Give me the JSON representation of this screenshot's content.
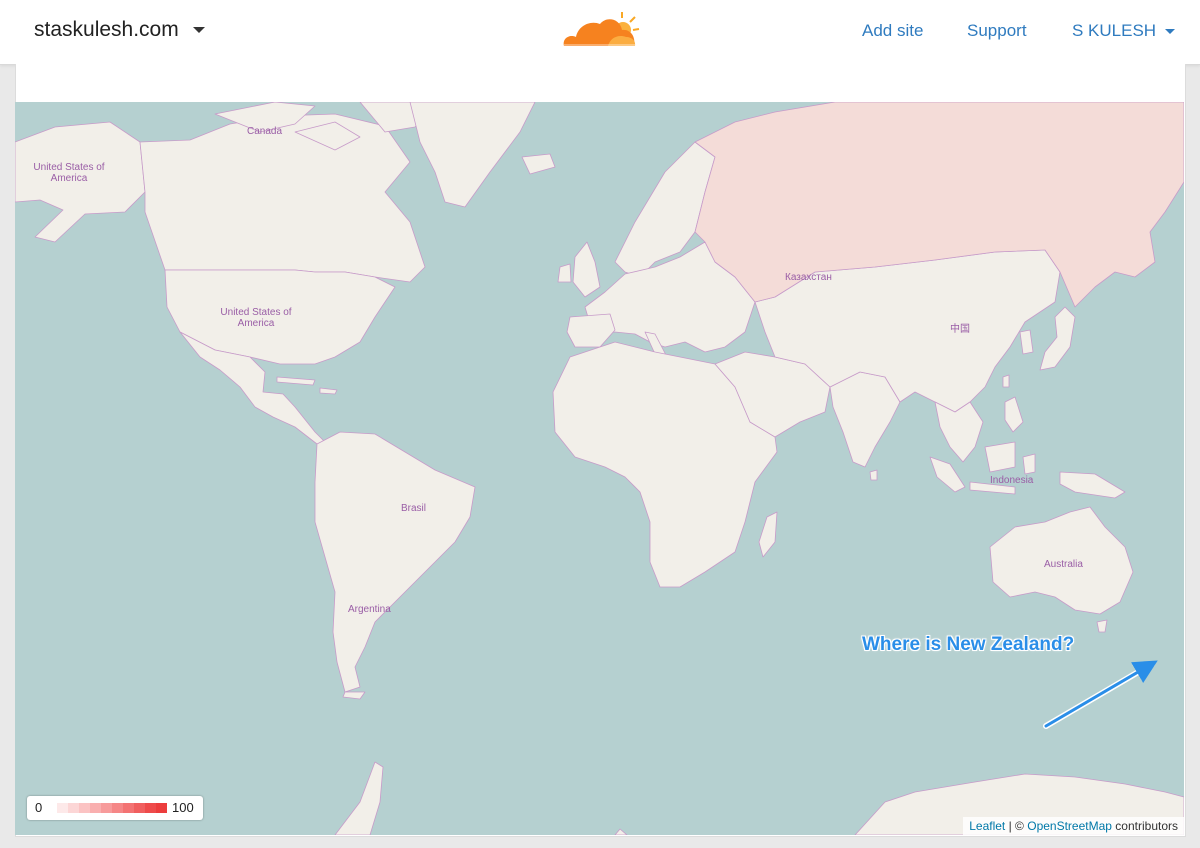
{
  "header": {
    "site_name": "staskulesh.com",
    "nav": {
      "add_site": "Add site",
      "support": "Support",
      "user": "S KULESH"
    },
    "logo_icon": "cloudflare-cloud-icon",
    "accent_color": "#2f7bbf"
  },
  "map": {
    "labels": {
      "canada": "Canada",
      "usa_alaska": "United States of America",
      "usa": "United States of America",
      "kazakhstan": "Казахстан",
      "china": "中国",
      "indonesia": "Indonesia",
      "brasil": "Brasil",
      "argentina": "Argentina",
      "australia": "Australia"
    },
    "colors": {
      "ocean": "#b5d0d0",
      "land": "#f2efe9",
      "highlight": "#f4dcd8",
      "border": "#c79bc9"
    },
    "highlighted_country": "Russia",
    "legend": {
      "min": "0",
      "max": "100",
      "ramp": [
        "#fde9e9",
        "#fcd6d6",
        "#fbc3c3",
        "#f9afaf",
        "#f79b9b",
        "#f58787",
        "#f37373",
        "#f05f5f",
        "#ee4b4b",
        "#ec3d3d"
      ]
    },
    "attribution": {
      "leaflet": "Leaflet",
      "separator": "| ©",
      "osm": "OpenStreetMap",
      "suffix": "contributors"
    }
  },
  "annotation": {
    "text": "Where is New Zealand?",
    "color": "#2a8ee8"
  }
}
